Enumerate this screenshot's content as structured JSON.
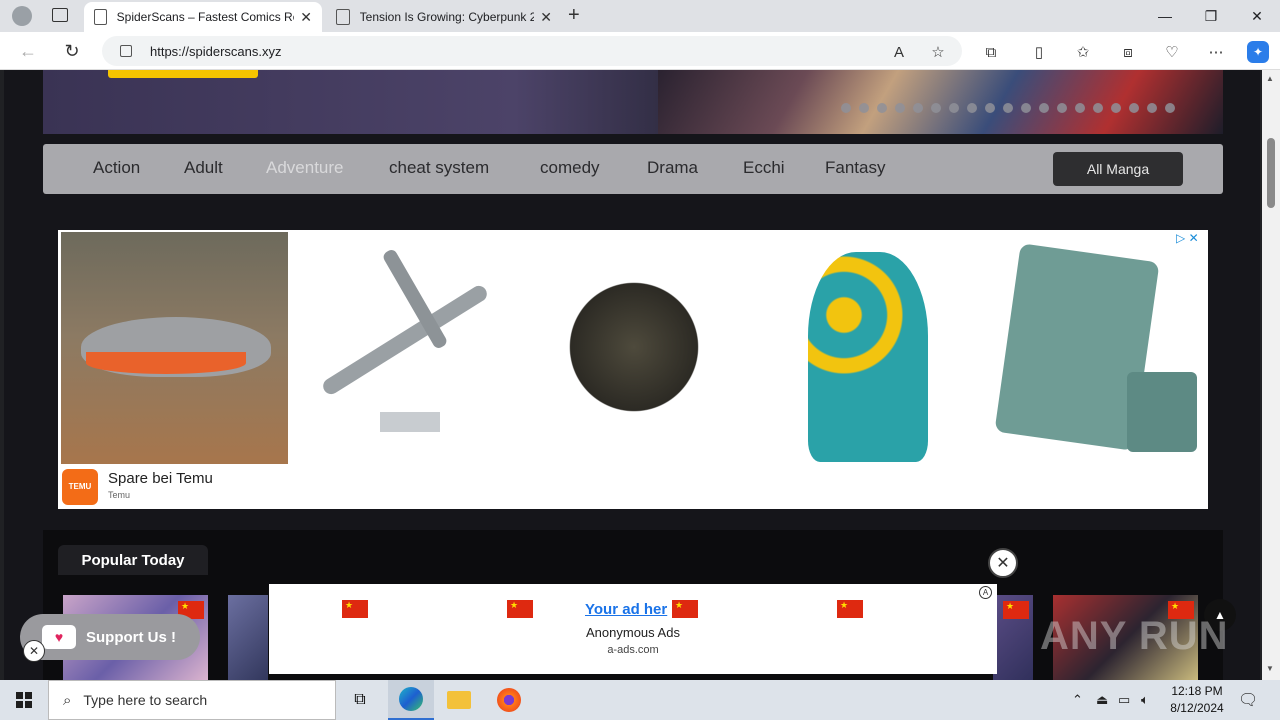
{
  "browser": {
    "tabs": [
      {
        "label": "SpiderScans – Fastest Comics Rel"
      },
      {
        "label": "Tension Is Growing: Cyberpunk 2"
      }
    ],
    "url": "https://spiderscans.xyz"
  },
  "genres": {
    "items": [
      "Action",
      "Adult",
      "Adventure",
      "cheat system",
      "comedy",
      "Drama",
      "Ecchi",
      "Fantasy"
    ],
    "all_manga_label": "All Manga"
  },
  "ad": {
    "title": "Spare bei Temu",
    "subtitle": "Temu",
    "brand_text": "TEMU",
    "product_icons": [
      "hammock",
      "b52-bomber-model",
      "pirate-ship-model",
      "floral-swimsuit",
      "wallet"
    ]
  },
  "popular": {
    "tab_label": "Popular Today"
  },
  "bottom_ad": {
    "link_text": "Your ad her",
    "name": "Anonymous Ads",
    "domain": "a-ads.com"
  },
  "support": {
    "label": "Support Us !"
  },
  "watermark": "ANY RUN",
  "taskbar": {
    "search_placeholder": "Type here to search",
    "time": "12:18 PM",
    "date": "8/12/2024"
  },
  "colors": {
    "accent_yellow": "#f5c400",
    "genre_bar": "#a9a9ad",
    "page_bg": "#15151a",
    "temu_orange": "#f36c17",
    "link_blue": "#1a73e8"
  }
}
